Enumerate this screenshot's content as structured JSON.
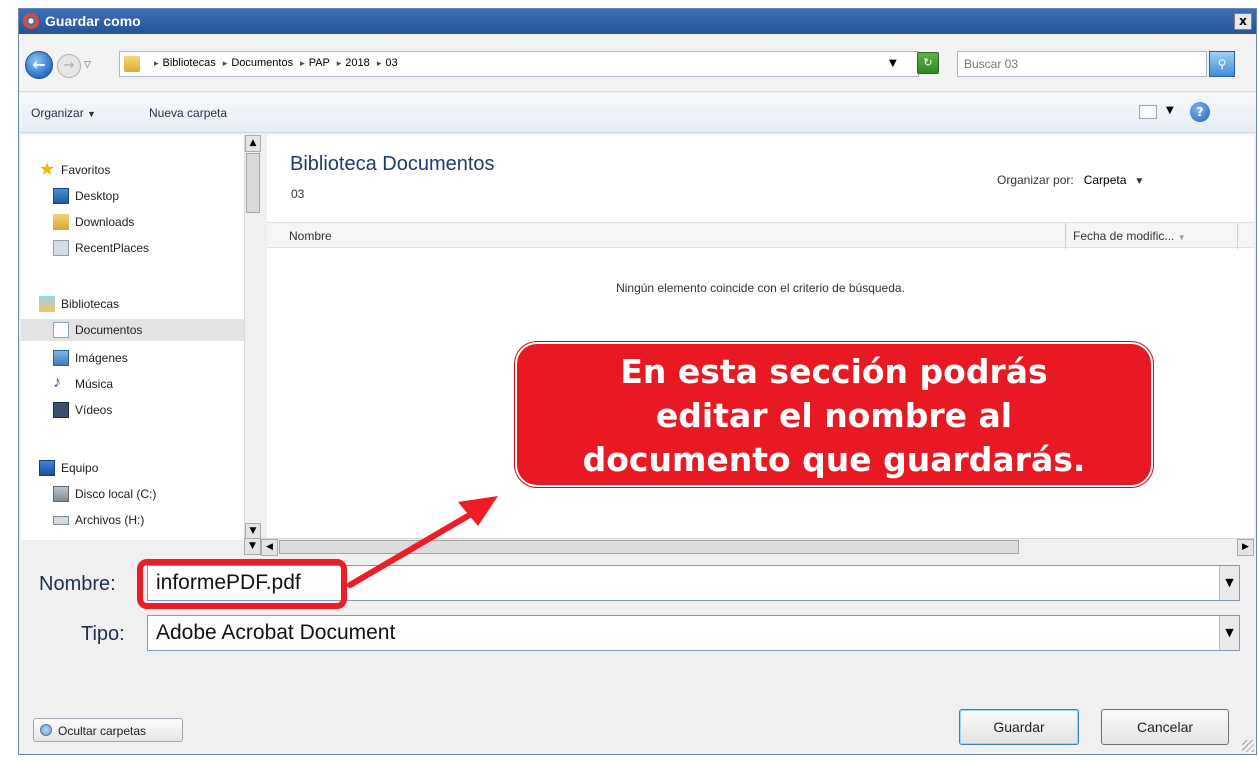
{
  "window": {
    "title": "Guardar como",
    "close_label": "x"
  },
  "address": {
    "crumbs": [
      "Bibliotecas",
      "Documentos",
      "PAP",
      "2018",
      "03"
    ],
    "search_placeholder": "Buscar 03"
  },
  "toolbar": {
    "organize_label": "Organizar",
    "new_folder_label": "Nueva carpeta",
    "help_label": "?"
  },
  "sidebar": {
    "favorites_label": "Favoritos",
    "favorites": [
      "Desktop",
      "Downloads",
      "RecentPlaces"
    ],
    "libraries_label": "Bibliotecas",
    "libraries": [
      "Documentos",
      "Imágenes",
      "Música",
      "Vídeos"
    ],
    "computer_label": "Equipo",
    "computer": [
      "Disco local (C:)",
      "Archivos (H:)"
    ]
  },
  "content": {
    "library_title": "Biblioteca Documentos",
    "library_subtitle": "03",
    "arrange_label": "Organizar por:",
    "arrange_value": "Carpeta",
    "col_name": "Nombre",
    "col_date": "Fecha de modific...",
    "empty_message": "Ningún elemento coincide con el criterio de búsqueda."
  },
  "form": {
    "name_label": "Nombre:",
    "name_value": "informePDF.pdf",
    "type_label": "Tipo:",
    "type_value": "Adobe Acrobat Document"
  },
  "footer": {
    "hide_folders_label": "Ocultar carpetas",
    "save_label": "Guardar",
    "cancel_label": "Cancelar"
  },
  "annotation": {
    "line1": "En esta sección podrás",
    "line2": "editar el nombre al",
    "line3": "documento que guardarás.",
    "color": "#e81922"
  }
}
